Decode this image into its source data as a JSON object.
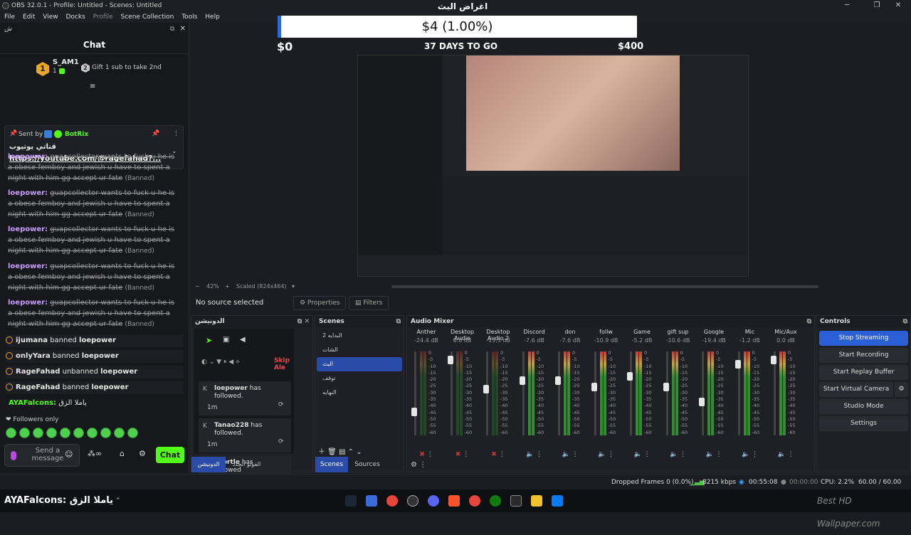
{
  "window": {
    "title": "OBS 32.0.1 - Profile: Untitled - Scenes: Untitled"
  },
  "menu": [
    "File",
    "Edit",
    "View",
    "Docks",
    "Profile",
    "Scene Collection",
    "Tools",
    "Help"
  ],
  "chatdock": {
    "dock_label": "ش",
    "title": "Chat",
    "top_user": {
      "rank": "1",
      "name": "S_AM1",
      "count": "1"
    },
    "gift_rank": "2",
    "gift_text": "Gift 1 sub to take 2nd",
    "pinned": {
      "sent_by": "Sent by",
      "bot": "BotRix",
      "line1": "قناتي يوتيوب",
      "link": "https://youtube.com/@ragefahad?..."
    },
    "messages": [
      {
        "user": "loepower:",
        "text": "guapcollector wants to fuck u he is a obese femboy and jewish u have to spent a night with him gg accept ur fate",
        "status": "(Banned)"
      },
      {
        "user": "loepower:",
        "text": "guapcollector wants to fuck u he is a obese femboy and jewish u have to spent a night with him gg accept ur fate",
        "status": "(Banned)"
      },
      {
        "user": "loepower:",
        "text": "guapcollector wants to fuck u he is a obese femboy and jewish u have to spent a night with him gg accept ur fate",
        "status": "(Banned)"
      },
      {
        "user": "loepower:",
        "text": "guapcollector wants to fuck u he is a obese femboy and jewish u have to spent a night with him gg accept ur fate",
        "status": "(Banned)"
      },
      {
        "user": "loepower:",
        "text": "guapcollector wants to fuck u he is a obese femboy and jewish u have to spent a night with him gg accept ur fate",
        "status": "(Banned)"
      }
    ],
    "mod_events": [
      {
        "actor": "ijumana",
        "action": "banned",
        "target": "loepower"
      },
      {
        "actor": "onlyYara",
        "action": "banned",
        "target": "loepower"
      },
      {
        "actor": "RageFahad",
        "action": "unbanned",
        "target": "loepower"
      },
      {
        "actor": "RageFahad",
        "action": "banned",
        "target": "loepower"
      }
    ],
    "last_msg": {
      "user": "AYAFalcons:",
      "text": "ياملا الزق"
    },
    "followers_only": "Followers only",
    "input_placeholder": "Send a message",
    "chat_button": "Chat"
  },
  "preview": {
    "goal_title": "اغراض البث",
    "goal_amount": "$4 (1.00%)",
    "goal_progress": 0.01,
    "goal_min": "$0",
    "goal_days": "37 DAYS TO GO",
    "goal_max": "$400",
    "zoom": "42%",
    "scaled": "Scaled (824x464)"
  },
  "sourcebar": {
    "no_source": "No source selected",
    "properties": "Properties",
    "filters": "Filters"
  },
  "activity_panel": {
    "title": "الدونيشن",
    "skip_label": "Skip Ale",
    "events": [
      {
        "name": "loepower",
        "text": "has followed.",
        "time": "1m"
      },
      {
        "name": "Tanao228",
        "text": "has followed.",
        "time": "1m"
      },
      {
        "name": "Scortle",
        "text": "has followed",
        "time": ""
      }
    ],
    "tabs": [
      "الدونيشن",
      "الفولو الجدد"
    ]
  },
  "scenes_panel": {
    "title": "Scenes",
    "items": [
      "البدايه 2",
      "الشات",
      "البث",
      "توقف",
      "النهايه"
    ],
    "selected": 2,
    "tabs": [
      "Scenes",
      "Sources"
    ]
  },
  "mixer": {
    "title": "Audio Mixer",
    "channels": [
      {
        "name": "Anther",
        "db": "-24.4 dB",
        "level": 0.28,
        "muted": true
      },
      {
        "name": "Desktop Audio",
        "db": "0.0 dB",
        "level": 0.9,
        "muted": true
      },
      {
        "name": "Desktop Audio 2",
        "db": "-13.5 dB",
        "level": 0.55,
        "muted": true
      },
      {
        "name": "Discord",
        "db": "-7.6 dB",
        "level": 0.65,
        "muted": false
      },
      {
        "name": "don",
        "db": "-7.6 dB",
        "level": 0.65,
        "muted": false
      },
      {
        "name": "follw",
        "db": "-10.9 dB",
        "level": 0.58,
        "muted": false
      },
      {
        "name": "Game",
        "db": "-5.2 dB",
        "level": 0.7,
        "muted": false
      },
      {
        "name": "gift sup",
        "db": "-10.6 dB",
        "level": 0.58,
        "muted": false
      },
      {
        "name": "Google",
        "db": "-19.4 dB",
        "level": 0.4,
        "muted": false
      },
      {
        "name": "Mic",
        "db": "-1.2 dB",
        "level": 0.85,
        "muted": false
      },
      {
        "name": "Mic/Aux",
        "db": "0.0 dB",
        "level": 0.9,
        "muted": false
      }
    ],
    "ticks": [
      "0",
      "-5",
      "-10",
      "-15",
      "-20",
      "-25",
      "-30",
      "-35",
      "-40",
      "-45",
      "-50",
      "-55",
      "-60"
    ]
  },
  "controls": {
    "title": "Controls",
    "buttons": [
      "Stop Streaming",
      "Start Recording",
      "Start Replay Buffer",
      "Start Virtual Camera",
      "Studio Mode",
      "Settings"
    ]
  },
  "status": {
    "dropped": "Dropped Frames 0 (0.0%)",
    "bitrate": "8215 kbps",
    "stream_time": "00:55:08",
    "rec_time": "00:00:00",
    "cpu": "CPU: 2.2%",
    "fps": "60.00 / 60.00 FPS"
  },
  "taskbar": {
    "overlay": "AYAFalcons: ياملا الزق",
    "watermark": "Best HD Wallpaper.com"
  }
}
